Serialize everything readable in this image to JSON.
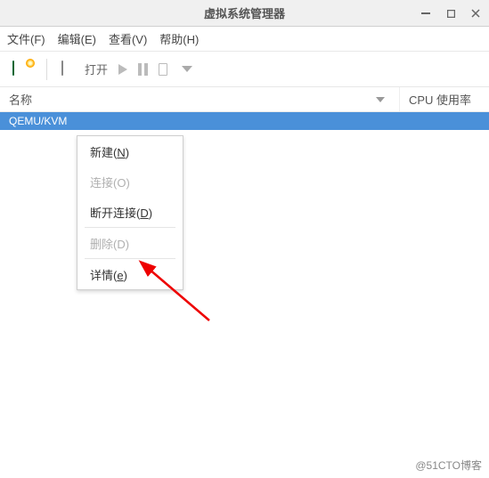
{
  "window": {
    "title": "虚拟系统管理器"
  },
  "menubar": {
    "file": "文件(F)",
    "edit": "编辑(E)",
    "view": "查看(V)",
    "help": "帮助(H)"
  },
  "toolbar": {
    "open_label": "打开"
  },
  "columns": {
    "name": "名称",
    "cpu": "CPU 使用率"
  },
  "connection": {
    "row_label": "QEMU/KVM"
  },
  "context_menu": {
    "new_label": "新建(",
    "new_accel": "N",
    "new_suffix": ")",
    "connect_label": "连接(O)",
    "disconnect_label": "断开连接(",
    "disconnect_accel": "D",
    "disconnect_suffix": ")",
    "delete_label": "删除(D)",
    "details_label": "详情(",
    "details_accel": "e",
    "details_suffix": ")"
  },
  "watermark": "@51CTO博客"
}
